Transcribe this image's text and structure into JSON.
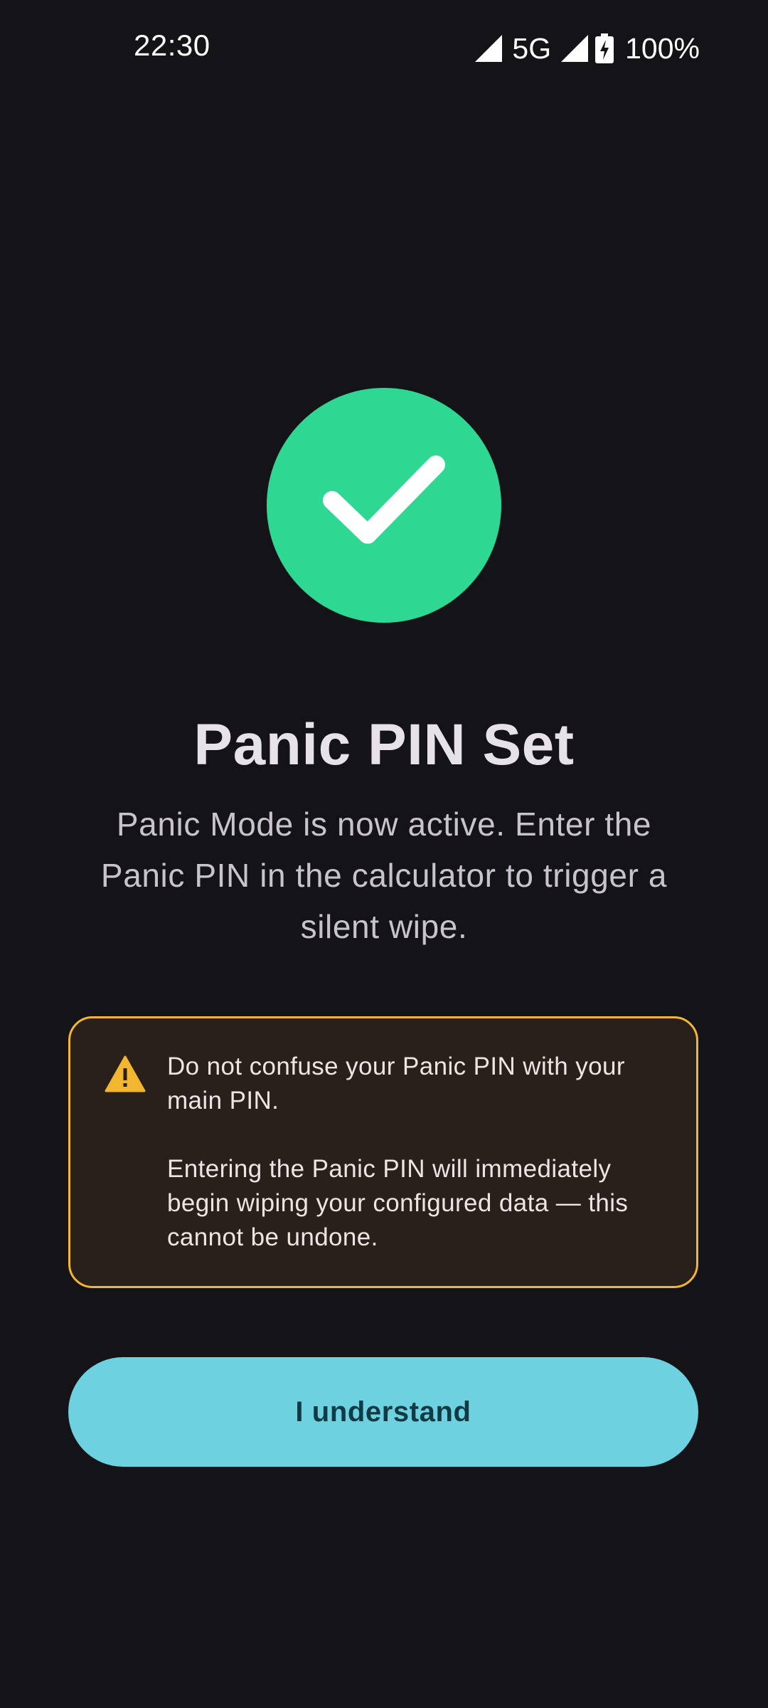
{
  "status_bar": {
    "time": "22:30",
    "network": "5G",
    "battery": "100%",
    "icons": [
      "signal-icon",
      "signal-icon",
      "battery-charging-icon"
    ]
  },
  "success": {
    "icon": "checkmark-icon",
    "color": "#2ed893"
  },
  "title": "Panic PIN Set",
  "subtitle": "Panic Mode is now active. Enter the Panic PIN in the calculator to trigger a silent wipe.",
  "warning": {
    "icon": "warning-icon",
    "accent_color": "#f2b62f",
    "line1": "Do not confuse your Panic PIN with your main PIN.",
    "line2": "Entering the Panic PIN will immediately begin wiping your configured data — this cannot be undone."
  },
  "button": {
    "label": "I understand",
    "color": "#6dd1e0"
  }
}
